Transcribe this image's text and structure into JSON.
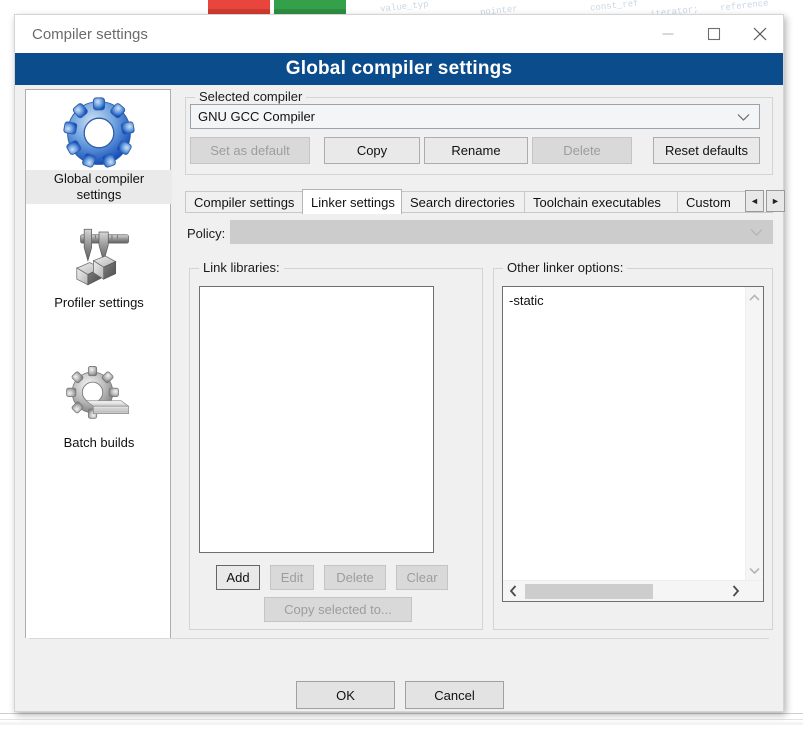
{
  "window": {
    "title": "Compiler settings",
    "banner": "Global compiler settings",
    "controls": {
      "minimize": "minimize",
      "maximize": "maximize",
      "close": "close"
    }
  },
  "sidebar": {
    "items": [
      {
        "label": "Global compiler settings",
        "icon": "blue-gear-icon",
        "selected": true
      },
      {
        "label": "Profiler settings",
        "icon": "caliper-icon",
        "selected": false
      },
      {
        "label": "Batch builds",
        "icon": "gear-stack-icon",
        "selected": false
      }
    ]
  },
  "selected_compiler": {
    "group_title": "Selected compiler",
    "combo_value": "GNU GCC Compiler",
    "buttons": [
      {
        "label": "Set as default",
        "enabled": false
      },
      {
        "label": "Copy",
        "enabled": true
      },
      {
        "label": "Rename",
        "enabled": true
      },
      {
        "label": "Delete",
        "enabled": false
      },
      {
        "label": "Reset defaults",
        "enabled": true
      }
    ]
  },
  "tabs": {
    "items": [
      {
        "label": "Compiler settings",
        "active": false
      },
      {
        "label": "Linker settings",
        "active": true
      },
      {
        "label": "Search directories",
        "active": false
      },
      {
        "label": "Toolchain executables",
        "active": false
      },
      {
        "label": "Custom",
        "active": false
      }
    ],
    "scroll_left": "◄",
    "scroll_right": "►"
  },
  "policy": {
    "label": "Policy:",
    "value": "",
    "enabled": false
  },
  "link_libraries": {
    "group_title": "Link libraries:",
    "items": [],
    "buttons": [
      {
        "label": "Add",
        "enabled": true
      },
      {
        "label": "Edit",
        "enabled": false
      },
      {
        "label": "Delete",
        "enabled": false
      },
      {
        "label": "Clear",
        "enabled": false
      }
    ],
    "copy_selected": {
      "label": "Copy selected to...",
      "enabled": false
    },
    "move_up": "▲",
    "move_down": "▼"
  },
  "other_linker_options": {
    "group_title": "Other linker options:",
    "value": "-static",
    "scroll_up": "⌃",
    "scroll_down": "⌄",
    "scroll_left": "‹",
    "scroll_right": "›"
  },
  "footer": {
    "ok": "OK",
    "cancel": "Cancel"
  },
  "background": {
    "code_snippets": [
      "value_typ",
      "pointer",
      "const_ref",
      "iterator;",
      "reference"
    ]
  },
  "colors": {
    "banner_blue": "#0b4c8c",
    "dialog_bg": "#f0f0f0",
    "logo_red": "#e8453c",
    "logo_green": "#34a04a"
  }
}
